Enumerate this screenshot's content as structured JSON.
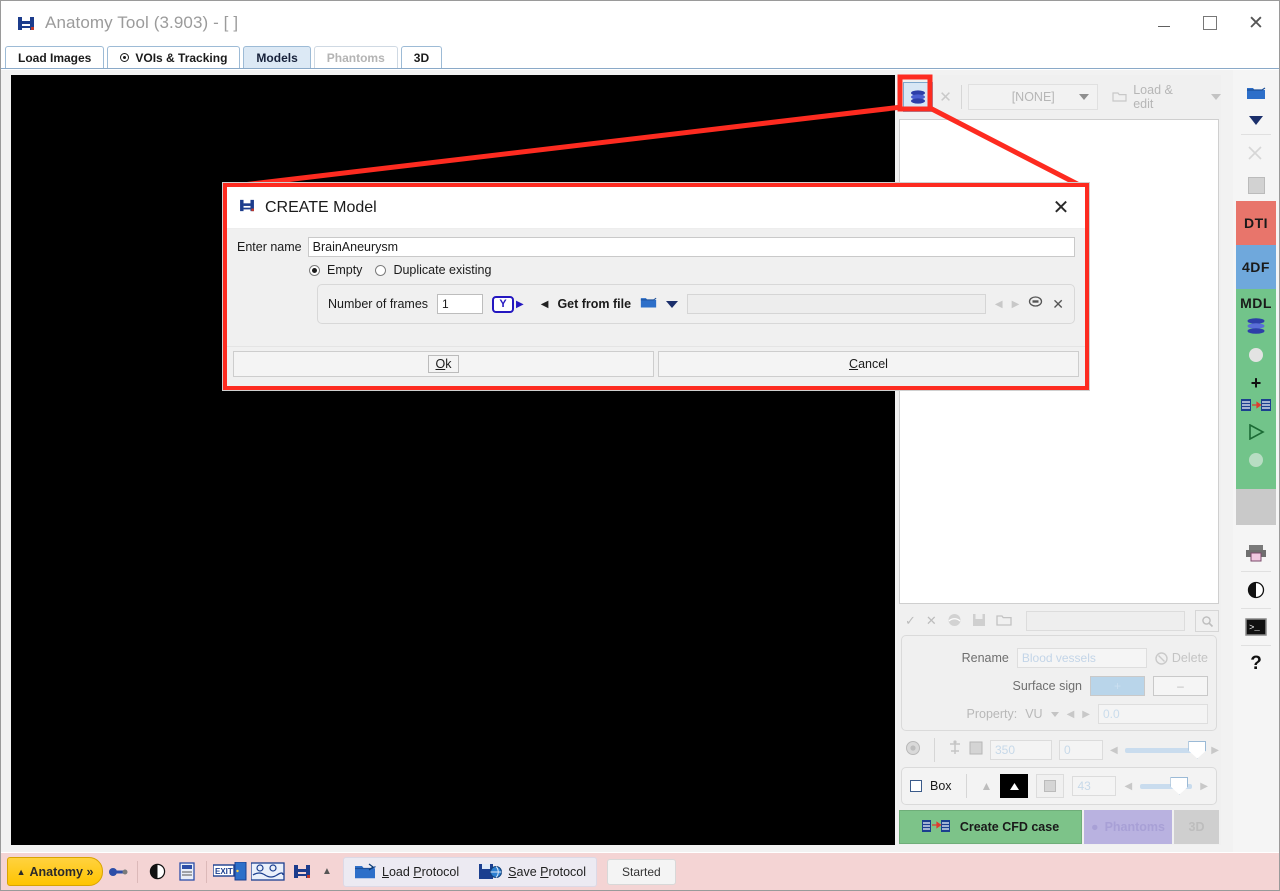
{
  "window": {
    "title": "Anatomy Tool (3.903) - [ ]",
    "app_icon": "anatomy-logo-icon",
    "minimize_label": "",
    "maximize_label": "",
    "close_label": "✕"
  },
  "tabs": [
    {
      "label": "Load Images",
      "state": "normal",
      "icon": null
    },
    {
      "label": "VOIs & Tracking",
      "state": "normal",
      "icon": "target-dot-icon"
    },
    {
      "label": "Models",
      "state": "active",
      "icon": null
    },
    {
      "label": "Phantoms",
      "state": "disabled",
      "icon": null
    },
    {
      "label": "3D",
      "state": "normal",
      "icon": null
    }
  ],
  "right_panel": {
    "toolbar": {
      "model_button_icon": "model-stack-icon",
      "clear_icon": "close-x-icon",
      "combo_value": "[NONE]",
      "combo_caret_icon": "chevron-down-icon",
      "load_edit_label": "Load & edit",
      "load_edit_icon": "open-folder-icon",
      "load_edit_caret_icon": "chevron-down-icon"
    },
    "icon_row": {
      "accept_icon": "check-icon",
      "cancel_icon": "close-x-icon",
      "eye_icon": "eye-icon",
      "save_icon": "save-icon",
      "open_icon": "open-folder-icon",
      "search_value": "",
      "search_icon": "magnifier-icon"
    },
    "properties": {
      "rename_label": "Rename",
      "rename_placeholder": "Blood vessels",
      "delete_label": "Delete",
      "delete_icon": "delete-gear-icon",
      "surface_sign_label": "Surface sign",
      "surface_plus": "+",
      "surface_minus": "–",
      "property_label": "Property:",
      "property_unit": "VU",
      "property_value": "0.0"
    },
    "slider_row": {
      "opacity_icon": "opacity-icon",
      "mesh_icon": "mesh-icon",
      "box_icon": "square-icon",
      "value_a": "350",
      "value_b": "0",
      "slider_percent": 92
    },
    "box_group": {
      "box_label": "Box",
      "up_icon": "triangle-up-icon",
      "black_btn_icon": "triangle-up-white-icon",
      "gray_btn_icon": "square-gray-icon",
      "value": "43",
      "slider_percent": 62
    },
    "actions": {
      "create_cfd_label": "Create CFD case",
      "create_cfd_icon": "cfd-transfer-icon",
      "phantoms_label": "Phantoms",
      "phantoms_icon": "phantom-icon",
      "three_d_label": "3D"
    }
  },
  "vertical_toolbar": {
    "items": [
      {
        "name": "open-folder-icon",
        "label": "",
        "band": "none"
      },
      {
        "name": "chevron-down-icon",
        "label": "",
        "band": "none"
      },
      {
        "name": "scissors-icon",
        "label": "",
        "band": "none"
      },
      {
        "name": "square-icon",
        "label": "",
        "band": "none"
      },
      {
        "name": "dti-button",
        "label": "DTI",
        "band": "dti"
      },
      {
        "name": "fourdf-button",
        "label": "4DF",
        "band": "4df"
      },
      {
        "name": "mdl-button",
        "label": "MDL",
        "band": "mdl"
      },
      {
        "name": "model-stack-icon",
        "label": "",
        "band": "mdl"
      },
      {
        "name": "sphere-icon",
        "label": "",
        "band": "mdl"
      },
      {
        "name": "plus-icon",
        "label": "+",
        "band": "mdl"
      },
      {
        "name": "cfd-transfer-icon",
        "label": "",
        "band": "mdl"
      },
      {
        "name": "play-icon",
        "label": "",
        "band": "mdl"
      },
      {
        "name": "sphere-dim-icon",
        "label": "",
        "band": "mdl"
      },
      {
        "name": "gray-block",
        "label": "",
        "band": "gray"
      },
      {
        "name": "printer-icon",
        "label": "",
        "band": "none"
      },
      {
        "name": "contrast-icon",
        "label": "",
        "band": "none"
      },
      {
        "name": "terminal-icon",
        "label": "",
        "band": "none"
      },
      {
        "name": "help-icon",
        "label": "?",
        "band": "none"
      }
    ]
  },
  "taskbar": {
    "anatomy_label": "Anatomy »",
    "anatomy_caret_icon": "triangle-up-icon",
    "icons": [
      "plug-icon",
      "contrast-icon",
      "report-icon",
      "exit-door-icon",
      "waveform-icon",
      "anatomy-logo-icon",
      "triangle-up-icon"
    ],
    "load_protocol_label": "Load Protocol",
    "load_protocol_icon": "open-folder-icon",
    "save_protocol_label": "Save Protocol",
    "save_protocol_icon": "save-globe-icon",
    "status_label": "Started"
  },
  "dialog": {
    "title": "CREATE Model",
    "title_icon": "anatomy-logo-icon",
    "close_label": "✕",
    "name_label": "Enter name",
    "name_value": "BrainAneurysm",
    "name_placeholder": "",
    "radio_empty_label": "Empty",
    "radio_duplicate_label": "Duplicate existing",
    "radio_selected": "Empty",
    "frames_label": "Number of frames",
    "frames_value": "1",
    "frames_icon": "y-axis-icon",
    "get_from_file_label": "Get from file",
    "get_from_file_icon": "open-folder-icon",
    "get_from_file_caret_icon": "chevron-down-icon",
    "file_path_value": "",
    "prev_icon": "arrow-left-icon",
    "next_icon": "arrow-right-icon",
    "link_icon": "link-icon",
    "clear_icon": "close-x-icon",
    "ok_label": "Ok",
    "cancel_label": "Cancel"
  },
  "highlight": {
    "color": "#fd2b20",
    "target": "model-create-button"
  }
}
